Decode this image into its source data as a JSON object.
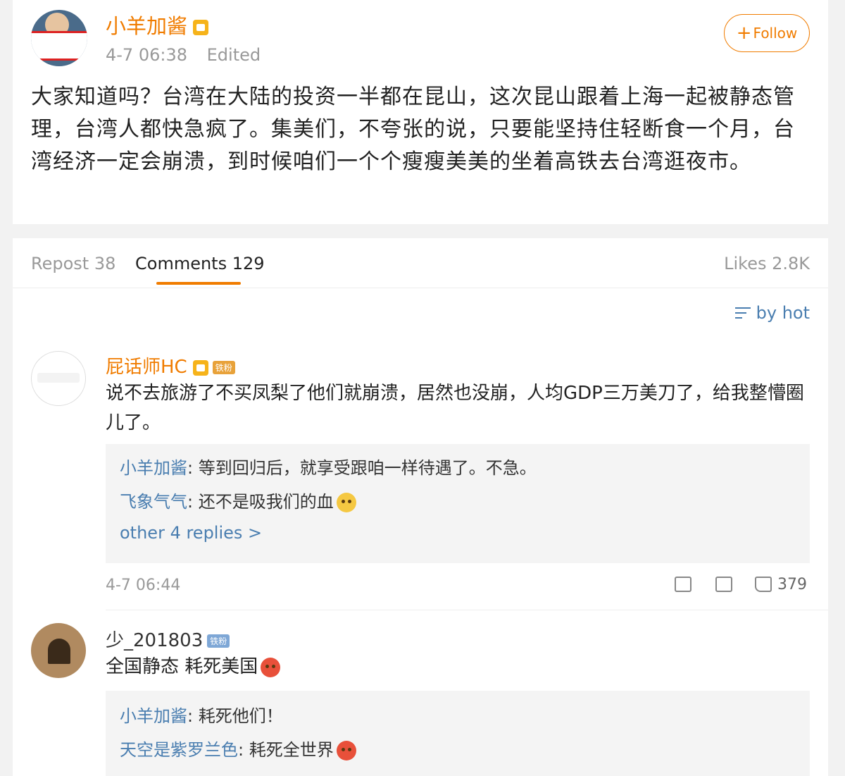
{
  "post": {
    "author": "小羊加酱",
    "time": "4-7 06:38",
    "edited": "Edited",
    "follow_label": "Follow",
    "text": "大家知道吗？台湾在大陆的投资一半都在昆山，这次昆山跟着上海一起被静态管理，台湾人都快急疯了。集美们，不夸张的说，只要能坚持住轻断食一个月，台湾经济一定会崩溃，到时候咱们一个个瘦瘦美美的坐着高铁去台湾逛夜市。"
  },
  "tabs": {
    "repost": "Repost 38",
    "comments": "Comments 129",
    "likes": "Likes 2.8K"
  },
  "sort_label": "by hot",
  "comments": [
    {
      "author": "屁话师HC",
      "badge": "铁粉",
      "text": "说不去旅游了不买凤梨了他们就崩溃，居然也没崩，人均GDP三万美刀了，给我整懵圈儿了。",
      "replies": [
        {
          "author": "小羊加酱",
          "text": ": 等到回归后，就享受跟咱一样待遇了。不急。"
        },
        {
          "author": "飞象气气",
          "text": ": 还不是吸我们的血"
        }
      ],
      "more_replies": "other 4 replies >",
      "time": "4-7 06:44",
      "likes": "379"
    },
    {
      "author": "少_201803",
      "badge": "铁粉",
      "text": "全国静态 耗死美国",
      "replies": [
        {
          "author": "小羊加酱",
          "text": ": 耗死他们！"
        },
        {
          "author": "天空是紫罗兰色",
          "text": ": 耗死全世界"
        }
      ]
    }
  ]
}
